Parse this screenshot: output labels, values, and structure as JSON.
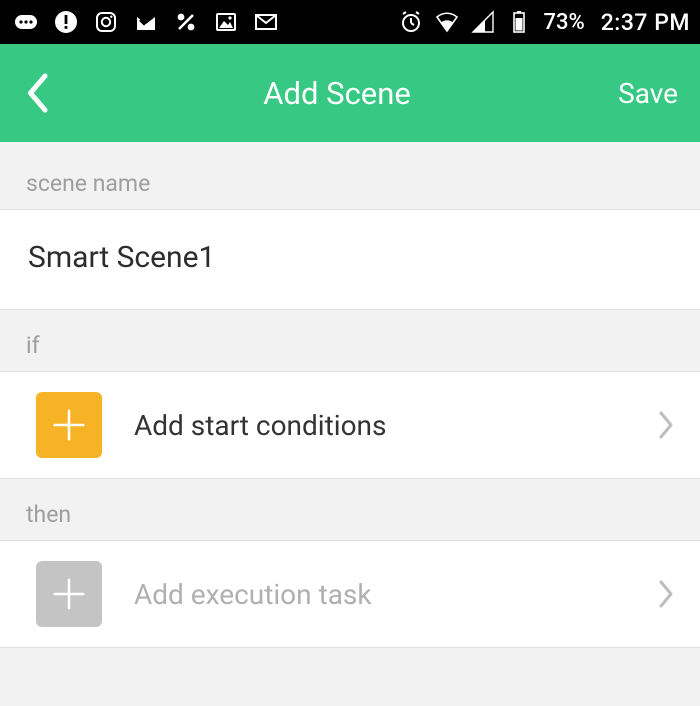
{
  "status": {
    "battery": "73%",
    "time": "2:37 PM"
  },
  "appbar": {
    "title": "Add Scene",
    "save": "Save"
  },
  "labels": {
    "scene_name": "scene name",
    "if": "if",
    "then": "then"
  },
  "scene_name_value": "Smart Scene1",
  "if_row": {
    "label": "Add start conditions"
  },
  "then_row": {
    "label": "Add execution task"
  }
}
